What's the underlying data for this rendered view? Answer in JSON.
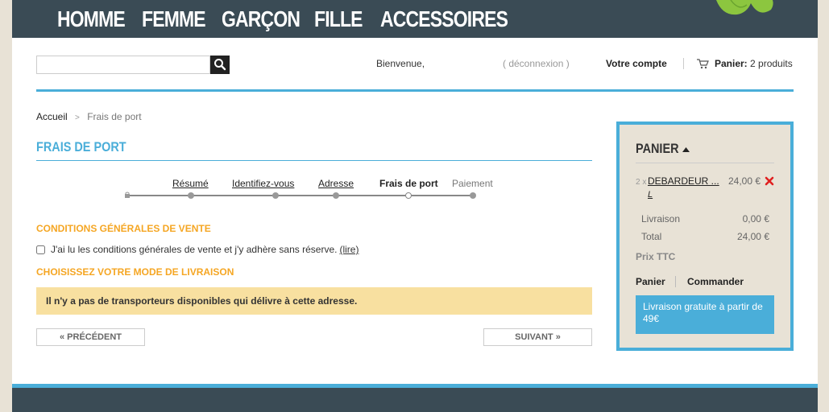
{
  "nav": {
    "items": [
      {
        "label": "HOMME"
      },
      {
        "label": "FEMME"
      },
      {
        "label": "GARÇON"
      },
      {
        "label": "FILLE"
      },
      {
        "label": "ACCESSOIRES"
      }
    ]
  },
  "header": {
    "search_value": "",
    "search_placeholder": "",
    "welcome": "Bienvenue,",
    "logout": "( déconnexion )",
    "account": "Votre compte",
    "cart_label": "Panier:",
    "cart_count": "2 produits"
  },
  "breadcrumb": {
    "home": "Accueil",
    "sep": ">",
    "current": "Frais de port"
  },
  "page": {
    "title": "FRAIS DE PORT"
  },
  "steps": [
    {
      "label": "Résumé"
    },
    {
      "label": "Identifiez-vous"
    },
    {
      "label": "Adresse"
    },
    {
      "label": "Frais de port"
    },
    {
      "label": "Paiement"
    }
  ],
  "conditions": {
    "title": "CONDITIONS GÉNÉRALES DE VENTE",
    "text": "J'ai lu les conditions générales de vente et j'y adhère sans réserve.",
    "link": "(lire)",
    "checked": false
  },
  "delivery": {
    "title": "CHOISISSEZ VOTRE MODE DE LIVRAISON",
    "message": "Il n'y a pas de transporteurs disponibles qui délivre à cette adresse."
  },
  "buttons": {
    "prev": "« PRÉCÉDENT",
    "next": "SUIVANT »"
  },
  "cart": {
    "title": "PANIER",
    "item": {
      "qty": "2 x",
      "name": "DEBARDEUR ...",
      "attr": "L",
      "price": "24,00 €"
    },
    "shipping_label": "Livraison",
    "shipping_value": "0,00 €",
    "total_label": "Total",
    "total_value": "24,00 €",
    "tax_note": "Prix TTC",
    "link_cart": "Panier",
    "link_order": "Commander",
    "free_shipping": "Livraison gratuite à partir de 49€"
  },
  "colors": {
    "nav_bg": "#3a4b55",
    "accent_blue": "#4aaed9",
    "accent_orange": "#f5a623",
    "alert_bg": "#f8e0a0",
    "page_bg": "#e8e2d6"
  },
  "icons": [
    "search-icon",
    "cart-icon",
    "caret-up-icon",
    "delete-x-icon",
    "lock-icon",
    "leaf-logo"
  ]
}
